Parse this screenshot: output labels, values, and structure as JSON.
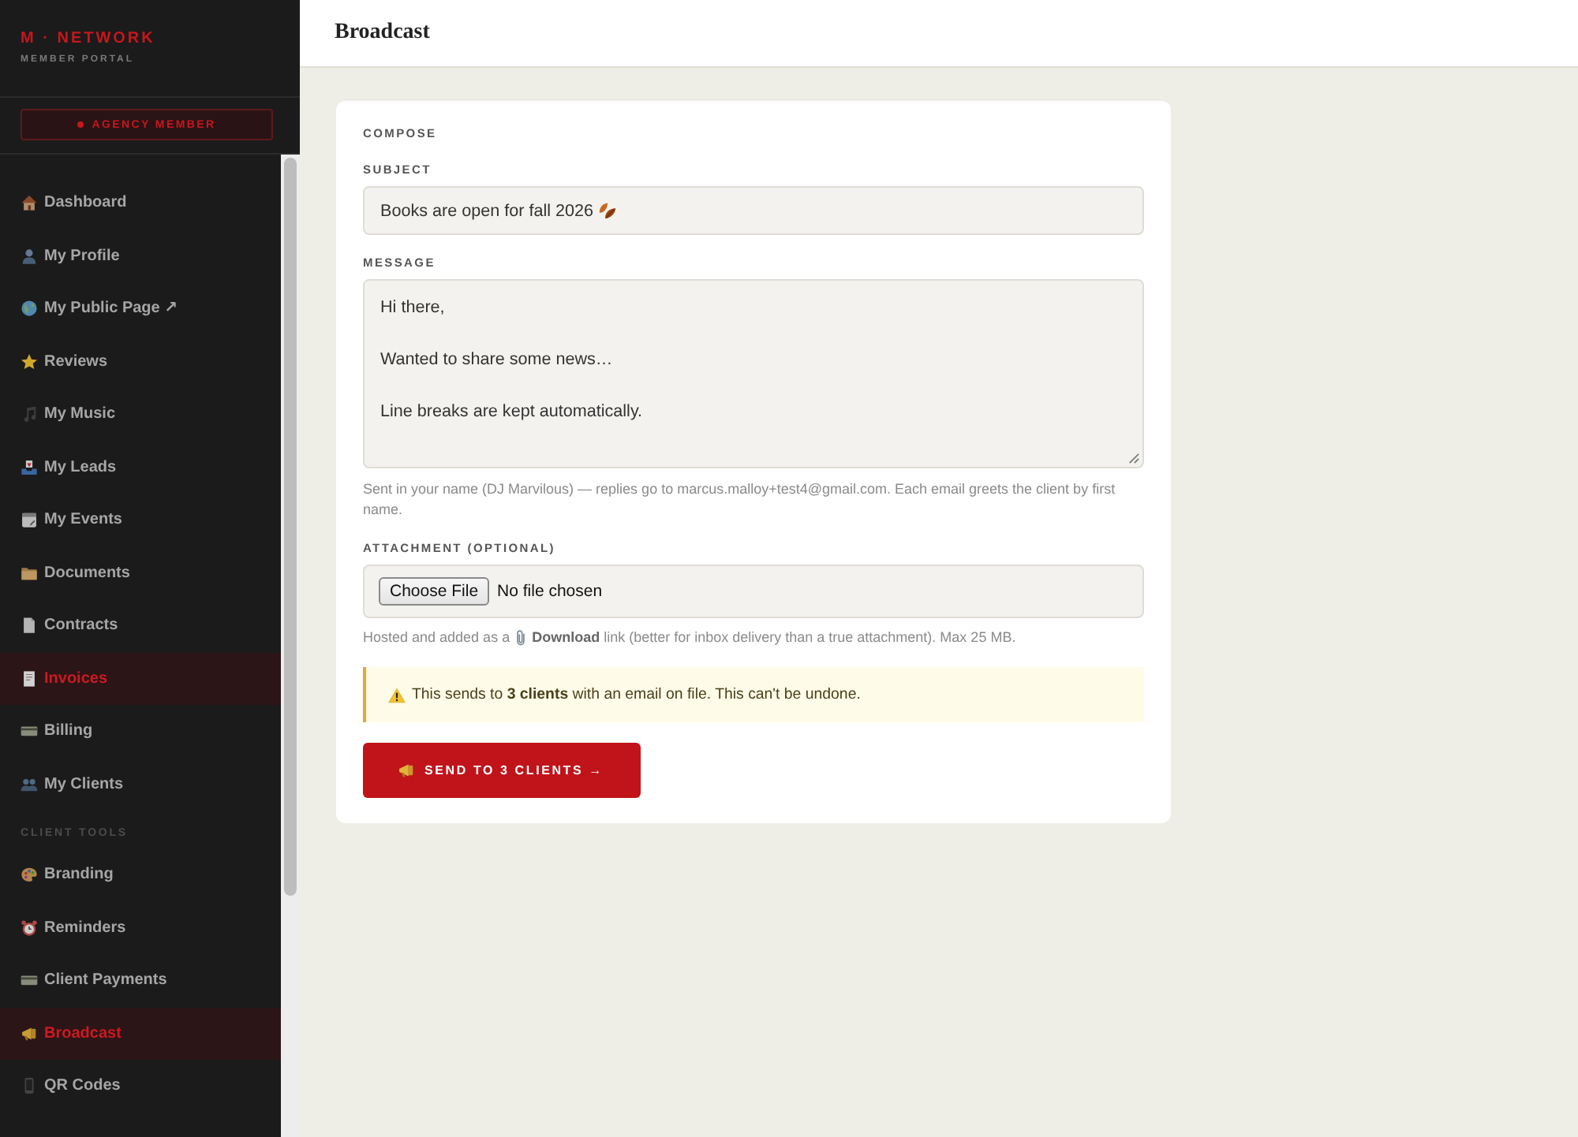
{
  "sidebar": {
    "brand": {
      "title": "M · NETWORK",
      "subtitle": "MEMBER PORTAL"
    },
    "badge": "AGENCY MEMBER",
    "sections": [
      {
        "items": [
          {
            "label": "Dashboard",
            "selected": false
          },
          {
            "label": "My Profile",
            "selected": false
          },
          {
            "label": "My Public Page ↗",
            "selected": false
          },
          {
            "label": "Reviews",
            "selected": false
          },
          {
            "label": "My Music",
            "selected": false
          },
          {
            "label": "My Leads",
            "selected": false
          },
          {
            "label": "My Events",
            "selected": false
          },
          {
            "label": "Documents",
            "selected": false
          },
          {
            "label": "Contracts",
            "selected": false
          },
          {
            "label": "Invoices",
            "selected": true
          },
          {
            "label": "Billing",
            "selected": false
          },
          {
            "label": "My Clients",
            "selected": false
          }
        ]
      },
      {
        "heading": "CLIENT TOOLS",
        "items": [
          {
            "label": "Branding",
            "selected": false
          },
          {
            "label": "Reminders",
            "selected": false
          },
          {
            "label": "Client Payments",
            "selected": false
          },
          {
            "label": "Broadcast",
            "selected": true
          },
          {
            "label": "QR Codes",
            "selected": false
          }
        ]
      }
    ]
  },
  "header": {
    "title": "Broadcast"
  },
  "compose": {
    "section_label": "COMPOSE",
    "subject": {
      "label": "SUBJECT",
      "value": "Books are open for fall 2026"
    },
    "message": {
      "label": "MESSAGE",
      "value": "Hi there,\n\nWanted to share some news…\n\nLine breaks are kept automatically."
    },
    "message_hint": "Sent in your name (DJ Marvilous) — replies go to marcus.malloy+test4@gmail.com. Each email greets the client by first name.",
    "attachment": {
      "label": "ATTACHMENT (OPTIONAL)",
      "button": "Choose File",
      "status": "No file chosen"
    },
    "attachment_hint": {
      "before": "Hosted and added as a",
      "after": "**Download** link (better for inbox delivery than a true attachment). Max 25 MB."
    },
    "warning": "This sends to **3 clients** with an email on file. This can't be undone.",
    "send_button": "SEND TO 3 CLIENTS →"
  }
}
